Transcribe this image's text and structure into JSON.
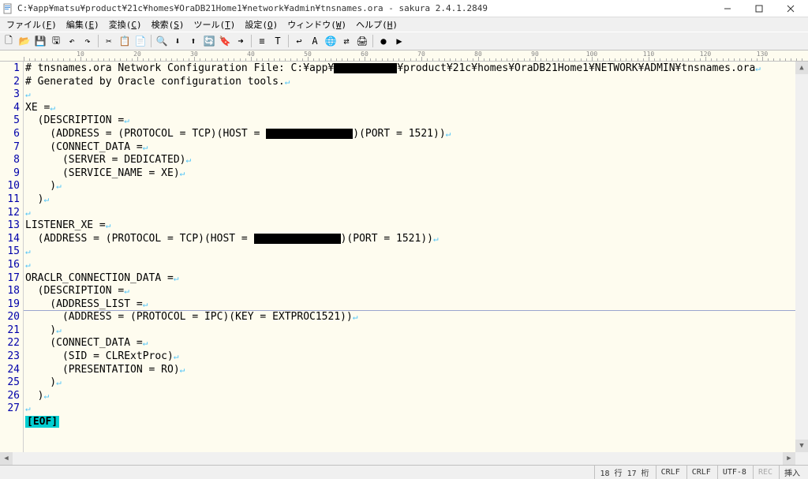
{
  "window": {
    "title": "C:¥app¥matsu¥product¥21c¥homes¥OraDB21Home1¥network¥admin¥tnsnames.ora - sakura 2.4.1.2849"
  },
  "menu": {
    "items": [
      {
        "label": "ファイル",
        "key": "F"
      },
      {
        "label": "編集",
        "key": "E"
      },
      {
        "label": "変換",
        "key": "C"
      },
      {
        "label": "検索",
        "key": "S"
      },
      {
        "label": "ツール",
        "key": "T"
      },
      {
        "label": "設定",
        "key": "O"
      },
      {
        "label": "ウィンドウ",
        "key": "W"
      },
      {
        "label": "ヘルプ",
        "key": "H"
      }
    ]
  },
  "code": {
    "lines": [
      {
        "n": 1,
        "segs": [
          {
            "t": "# tnsnames.ora Network Configuration File: C:¥app¥"
          },
          {
            "r": 80
          },
          {
            "t": "¥product¥21c¥homes¥OraDB21Home1¥NETWORK¥ADMIN¥tnsnames.ora"
          }
        ],
        "eol": true
      },
      {
        "n": 2,
        "segs": [
          {
            "t": "# Generated by Oracle configuration tools."
          }
        ],
        "eol": true
      },
      {
        "n": 3,
        "segs": [],
        "eol": true
      },
      {
        "n": 4,
        "segs": [
          {
            "t": "XE ="
          }
        ],
        "eol": true
      },
      {
        "n": 5,
        "segs": [
          {
            "t": "  (DESCRIPTION ="
          }
        ],
        "eol": true
      },
      {
        "n": 6,
        "segs": [
          {
            "t": "    (ADDRESS = (PROTOCOL = TCP)(HOST = "
          },
          {
            "r": 110
          },
          {
            "t": ")(PORT = 1521))"
          }
        ],
        "eol": true
      },
      {
        "n": 7,
        "segs": [
          {
            "t": "    (CONNECT_DATA ="
          }
        ],
        "eol": true
      },
      {
        "n": 8,
        "segs": [
          {
            "t": "      (SERVER = DEDICATED)"
          }
        ],
        "eol": true
      },
      {
        "n": 9,
        "segs": [
          {
            "t": "      (SERVICE_NAME = XE)"
          }
        ],
        "eol": true
      },
      {
        "n": 10,
        "segs": [
          {
            "t": "    )"
          }
        ],
        "eol": true
      },
      {
        "n": 11,
        "segs": [
          {
            "t": "  )"
          }
        ],
        "eol": true
      },
      {
        "n": 12,
        "segs": [],
        "eol": true
      },
      {
        "n": 13,
        "segs": [
          {
            "t": "LISTENER_XE ="
          }
        ],
        "eol": true
      },
      {
        "n": 14,
        "segs": [
          {
            "t": "  (ADDRESS = (PROTOCOL = TCP)(HOST = "
          },
          {
            "r": 110
          },
          {
            "t": ")(PORT = 1521))"
          }
        ],
        "eol": true
      },
      {
        "n": 15,
        "segs": [],
        "eol": true
      },
      {
        "n": 16,
        "segs": [],
        "eol": true
      },
      {
        "n": 17,
        "segs": [
          {
            "t": "ORACLR_CONNECTION_DATA ="
          }
        ],
        "eol": true
      },
      {
        "n": 18,
        "segs": [
          {
            "t": "  (DESCRIPTION ="
          }
        ],
        "eol": true
      },
      {
        "n": 19,
        "segs": [
          {
            "t": "    (ADDRESS_LIST ="
          }
        ],
        "eol": true
      },
      {
        "n": 20,
        "segs": [
          {
            "t": "      (ADDRESS = (PROTOCOL = IPC)(KEY = EXTPROC1521))"
          }
        ],
        "eol": true
      },
      {
        "n": 21,
        "segs": [
          {
            "t": "    )"
          }
        ],
        "eol": true
      },
      {
        "n": 22,
        "segs": [
          {
            "t": "    (CONNECT_DATA ="
          }
        ],
        "eol": true
      },
      {
        "n": 23,
        "segs": [
          {
            "t": "      (SID = CLRExtProc)"
          }
        ],
        "eol": true
      },
      {
        "n": 24,
        "segs": [
          {
            "t": "      (PRESENTATION = RO)"
          }
        ],
        "eol": true
      },
      {
        "n": 25,
        "segs": [
          {
            "t": "    )"
          }
        ],
        "eol": true
      },
      {
        "n": 26,
        "segs": [
          {
            "t": "  )"
          }
        ],
        "eol": true
      },
      {
        "n": 27,
        "segs": [],
        "eol": true
      }
    ],
    "eof_label": "[EOF]",
    "cursor_line_index": 18
  },
  "status": {
    "position": "18 行 17 桁",
    "crlf1": "CRLF",
    "crlf2": "CRLF",
    "encoding": "UTF-8",
    "rec": "REC",
    "mode": "挿入"
  },
  "toolbar_icons": [
    "new-icon",
    "open-icon",
    "save-icon",
    "saveall-icon",
    "undo-icon",
    "redo-icon",
    "sep",
    "cut-icon",
    "copy-icon",
    "paste-icon",
    "sep",
    "find-icon",
    "findnext-icon",
    "findprev-icon",
    "replace-icon",
    "mark-icon",
    "jump-icon",
    "sep",
    "outline-icon",
    "type-icon",
    "sep",
    "wrap-icon",
    "font-icon",
    "browser-icon",
    "compare-icon",
    "print-icon",
    "sep",
    "record-icon",
    "play-icon"
  ],
  "toolbar_glyphs": {
    "new-icon": "🗋",
    "open-icon": "📂",
    "save-icon": "💾",
    "saveall-icon": "🖫",
    "undo-icon": "↶",
    "redo-icon": "↷",
    "cut-icon": "✂",
    "copy-icon": "📋",
    "paste-icon": "📄",
    "find-icon": "🔍",
    "findnext-icon": "⬇",
    "findprev-icon": "⬆",
    "replace-icon": "🔄",
    "mark-icon": "🔖",
    "jump-icon": "➜",
    "outline-icon": "≡",
    "type-icon": "T",
    "wrap-icon": "↩",
    "font-icon": "A",
    "browser-icon": "🌐",
    "compare-icon": "⇄",
    "print-icon": "🖨",
    "record-icon": "●",
    "play-icon": "▶"
  }
}
